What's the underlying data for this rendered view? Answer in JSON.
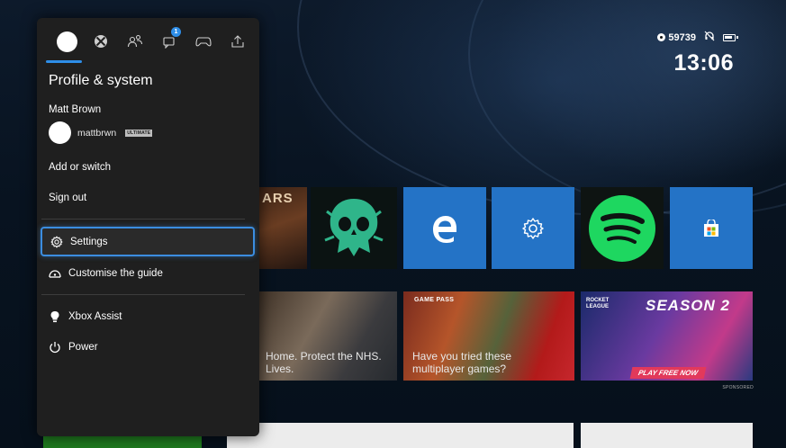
{
  "status": {
    "gamerscore": "59739",
    "time": "13:06"
  },
  "guide": {
    "tabs": [
      {
        "name": "profile-tab"
      },
      {
        "name": "xbox-tab"
      },
      {
        "name": "people-tab"
      },
      {
        "name": "messages-tab",
        "badge": "1"
      },
      {
        "name": "controller-tab"
      },
      {
        "name": "share-tab"
      }
    ],
    "title": "Profile & system",
    "user": {
      "name": "Matt Brown",
      "gamertag": "mattbrwn",
      "tier": "ULTIMATE"
    },
    "items": {
      "add_switch": "Add or switch",
      "sign_out": "Sign out",
      "settings": "Settings",
      "customise": "Customise the guide",
      "xbox_assist": "Xbox Assist",
      "power": "Power"
    }
  },
  "tiles": {
    "gears_title": "ARS",
    "wide1_text": "Home. Protect the NHS. Lives.",
    "wide2_badge": "GAME PASS",
    "wide2_text": "Have you tried these multiplayer games?",
    "wide3_logo": "ROCKET LEAGUE",
    "wide3_season": "SEASON 2",
    "wide3_cta": "PLAY FREE NOW",
    "sponsored": "SPONSORED"
  },
  "colors": {
    "accent": "#2e8ee8",
    "tile_blue": "#2473c6",
    "spotify_green": "#1ed760"
  }
}
